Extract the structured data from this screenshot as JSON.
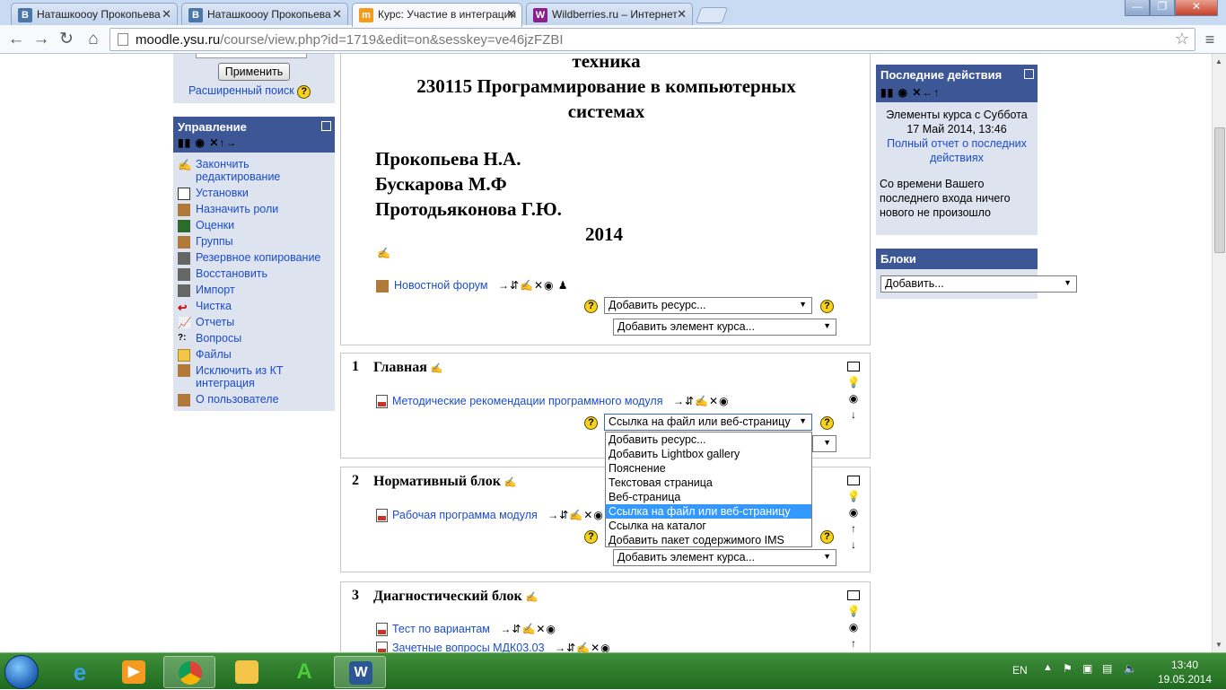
{
  "browser": {
    "tabs": [
      {
        "title": "Наташкоооу Прокопьева",
        "favicon": "В",
        "color": "#4a76a8",
        "active": false
      },
      {
        "title": "Наташкоооу Прокопьева",
        "favicon": "В",
        "color": "#4a76a8",
        "active": false
      },
      {
        "title": "Курс: Участие в интеграции",
        "favicon": "m",
        "color": "#f29b1d",
        "active": true
      },
      {
        "title": "Wildberries.ru – Интернет",
        "favicon": "W",
        "color": "#8b1f8b",
        "active": false
      }
    ],
    "url_host": "moodle.ysu.ru",
    "url_path": "/course/view.php?id=1719&edit=on&sesskey=ve46jzFZBI"
  },
  "left": {
    "apply_button": "Применить",
    "advanced_search": "Расширенный поиск",
    "admin_title": "Управление",
    "admin_items": [
      {
        "label": "Закончить редактирование",
        "icon": "edit-icon"
      },
      {
        "label": "Установки",
        "icon": "settings-icon"
      },
      {
        "label": "Назначить роли",
        "icon": "roles-icon"
      },
      {
        "label": "Оценки",
        "icon": "grades-icon"
      },
      {
        "label": "Группы",
        "icon": "groups-icon"
      },
      {
        "label": "Резервное копирование",
        "icon": "backup-icon"
      },
      {
        "label": "Восстановить",
        "icon": "restore-icon"
      },
      {
        "label": "Импорт",
        "icon": "import-icon"
      },
      {
        "label": "Чистка",
        "icon": "reset-icon"
      },
      {
        "label": "Отчеты",
        "icon": "reports-icon"
      },
      {
        "label": "Вопросы",
        "icon": "questions-icon"
      },
      {
        "label": "Файлы",
        "icon": "folder-icon"
      },
      {
        "label": "Исключить из КТ интеграция",
        "icon": "unenrol-icon"
      },
      {
        "label": "О пользователе",
        "icon": "user-icon"
      }
    ]
  },
  "center": {
    "heading_line1": "техника",
    "heading_line2": "230115 Программирование в компьютерных",
    "heading_line3": "системах",
    "authors": [
      "Прокопьева Н.А.",
      "Бускарова М.Ф",
      "Протодьяконова Г.Ю."
    ],
    "year": "2014",
    "news_forum": "Новостной форум",
    "add_resource": "Добавить ресурс...",
    "add_activity": "Добавить элемент курса...",
    "sections": [
      {
        "num": "1",
        "title": "Главная",
        "items": [
          "Методические рекомендации программного модуля"
        ],
        "resource_select": "Ссылка на файл или веб-страницу"
      },
      {
        "num": "2",
        "title": "Нормативный блок",
        "items": [
          "Рабочая программа модуля"
        ],
        "activity_select": "Добавить элемент курса..."
      },
      {
        "num": "3",
        "title": "Диагностический блок",
        "items": [
          "Тест по вариантам",
          "Зачетные вопросы МДК03.03"
        ]
      }
    ],
    "dropdown_options": [
      "Добавить ресурс...",
      "Добавить Lightbox gallery",
      "Пояснение",
      "Текстовая страница",
      "Веб-страница",
      "Ссылка на файл или веб-страницу",
      "Ссылка на каталог",
      "Добавить пакет содержимого IMS"
    ],
    "dropdown_selected_index": 5
  },
  "right": {
    "recent_title": "Последние действия",
    "recent_since": "Элементы курса с Суббота 17 Май 2014, 13:46",
    "recent_full_report": "Полный отчет о последних действиях",
    "recent_nothing": "Со времени Вашего последнего входа ничего нового не произошло",
    "blocks_title": "Блоки",
    "blocks_select": "Добавить..."
  },
  "taskbar": {
    "lang": "EN",
    "time": "13:40",
    "date": "19.05.2014"
  }
}
